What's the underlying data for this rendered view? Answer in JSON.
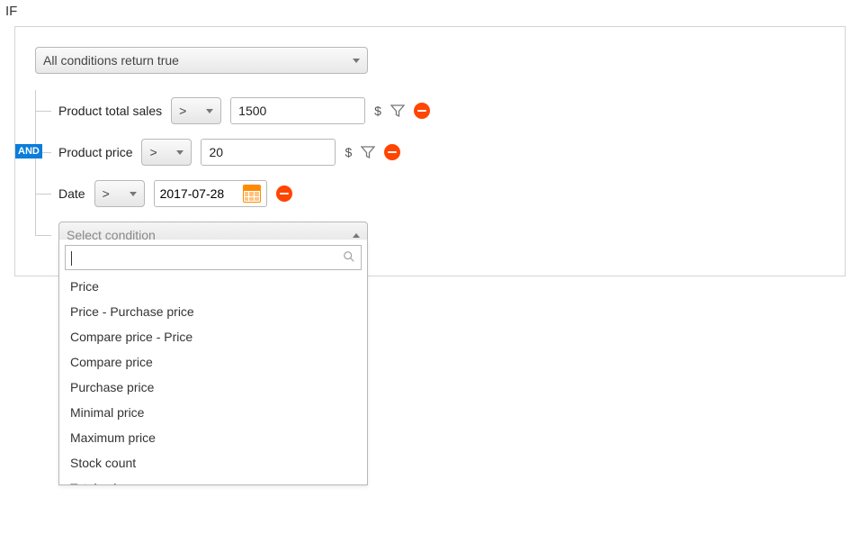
{
  "if_label": "IF",
  "main_condition": {
    "selected_label": "All conditions return true"
  },
  "and_badge": "AND",
  "rows": [
    {
      "label": "Product total sales",
      "operator": ">",
      "value": "1500",
      "unit": "$"
    },
    {
      "label": "Product price",
      "operator": ">",
      "value": "20",
      "unit": "$"
    },
    {
      "label": "Date",
      "operator": ">",
      "value": "2017-07-28"
    }
  ],
  "select_condition": {
    "placeholder": "Select condition",
    "search_value": "",
    "options": [
      "Price",
      "Price - Purchase price",
      "Compare price - Price",
      "Compare price",
      "Purchase price",
      "Minimal price",
      "Maximum price",
      "Stock count",
      "Total sales"
    ]
  }
}
